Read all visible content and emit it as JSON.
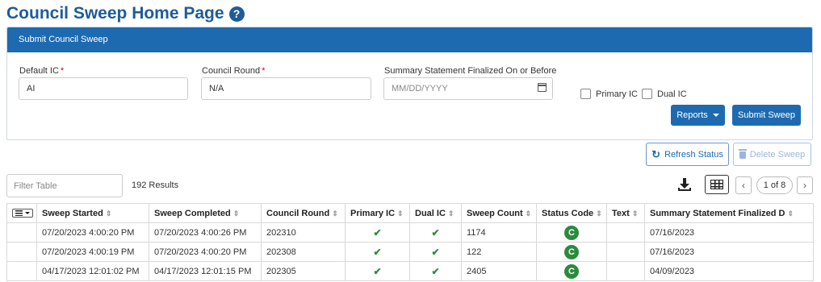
{
  "page": {
    "title": "Council Sweep Home Page"
  },
  "panel": {
    "header": "Submit Council Sweep",
    "default_ic": {
      "label": "Default IC",
      "value": "AI"
    },
    "council_round": {
      "label": "Council Round",
      "value": "N/A"
    },
    "summary_date": {
      "label": "Summary Statement Finalized On or Before",
      "placeholder": "MM/DD/YYYY"
    },
    "primary_ic_label": "Primary IC",
    "dual_ic_label": "Dual IC",
    "reports_label": "Reports",
    "submit_label": "Submit Sweep"
  },
  "actions": {
    "refresh_label": "Refresh Status",
    "delete_label": "Delete Sweep"
  },
  "table_controls": {
    "filter_placeholder": "Filter Table",
    "result_count": "192 Results",
    "page_indicator": "1 of 8",
    "prev": "‹",
    "next": "›"
  },
  "table": {
    "columns": [
      "Sweep Started",
      "Sweep Completed",
      "Council Round",
      "Primary IC",
      "Dual IC",
      "Sweep Count",
      "Status Code",
      "Text",
      "Summary Statement Finalized D"
    ],
    "check_glyph": "✔",
    "rows": [
      {
        "started": "07/20/2023 4:00:20 PM",
        "completed": "07/20/2023 4:00:26 PM",
        "round": "202310",
        "count": "1174",
        "status": "C",
        "text": "",
        "finalized": "07/16/2023"
      },
      {
        "started": "07/20/2023 4:00:19 PM",
        "completed": "07/20/2023 4:00:20 PM",
        "round": "202308",
        "count": "122",
        "status": "C",
        "text": "",
        "finalized": "07/16/2023"
      },
      {
        "started": "04/17/2023 12:01:02 PM",
        "completed": "04/17/2023 12:01:15 PM",
        "round": "202305",
        "count": "2405",
        "status": "C",
        "text": "",
        "finalized": "04/09/2023"
      }
    ]
  },
  "colors": {
    "brand": "#1d6ab1",
    "title": "#1e5c9a",
    "status_complete": "#2b8a3e",
    "check": "#2e8b3a",
    "required": "#d0021b"
  }
}
